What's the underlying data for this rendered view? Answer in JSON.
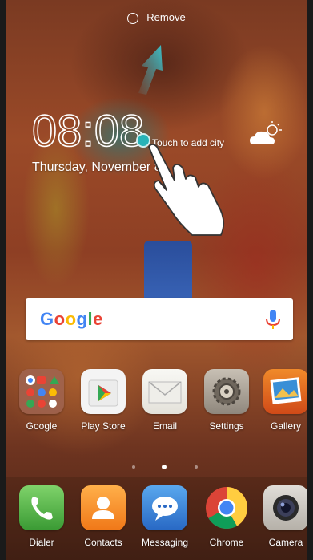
{
  "top_bar": {
    "remove_label": "Remove"
  },
  "lock_widget": {
    "time": "08:08",
    "date": "Thursday, November 8",
    "city_prompt": "Touch to add city"
  },
  "search": {
    "logo": "Google",
    "logo_colors": [
      "#4285F4",
      "#EA4335",
      "#FBBC05",
      "#4285F4",
      "#34A853",
      "#EA4335"
    ]
  },
  "home_row": [
    {
      "label": "Google",
      "icon": "google-folder-icon"
    },
    {
      "label": "Play Store",
      "icon": "play-store-icon"
    },
    {
      "label": "Email",
      "icon": "email-icon"
    },
    {
      "label": "Settings",
      "icon": "settings-icon"
    },
    {
      "label": "Gallery",
      "icon": "gallery-icon"
    }
  ],
  "page_indicator": {
    "pages": 3,
    "current": 2
  },
  "dock": [
    {
      "label": "Dialer",
      "icon": "phone-icon"
    },
    {
      "label": "Contacts",
      "icon": "contacts-icon"
    },
    {
      "label": "Messaging",
      "icon": "messaging-icon"
    },
    {
      "label": "Chrome",
      "icon": "chrome-icon"
    },
    {
      "label": "Camera",
      "icon": "camera-icon"
    }
  ]
}
